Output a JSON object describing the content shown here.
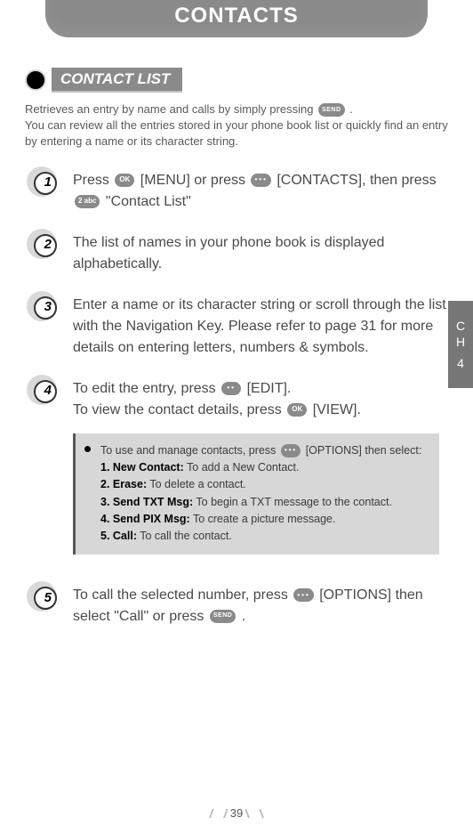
{
  "header": {
    "title": "CONTACTS"
  },
  "section": {
    "title": "CONTACT LIST"
  },
  "intro_line1": "Retrieves an entry by name and calls by simply pressing ",
  "intro_line1_tail": " .",
  "intro_line2": "You can review all the entries stored in your phone book list or quickly find an entry by entering a name or its character string.",
  "steps": {
    "s1": {
      "num": "1",
      "a": "Press ",
      "b": " [MENU] or press ",
      "c": " [CONTACTS], then press ",
      "d": " \"Contact List\""
    },
    "s2": {
      "num": "2",
      "text": "The list of names in your phone book is displayed alphabetically."
    },
    "s3": {
      "num": "3",
      "text": "Enter a name or its character string or scroll through the list with the Navigation Key. Please refer to page 31 for more details on entering letters, numbers & symbols."
    },
    "s4": {
      "num": "4",
      "a": "To edit the entry, press ",
      "b": " [EDIT].",
      "c": "To view the contact details, press ",
      "d": " [VIEW]."
    },
    "s5": {
      "num": "5",
      "a": "To call the selected number, press ",
      "b": " [OPTIONS] then select \"Call\" or press ",
      "c": " ."
    }
  },
  "options": {
    "lead_a": "To use and manage contacts, press ",
    "lead_b": " [OPTIONS] then select:",
    "o1b": "1. New Contact:",
    "o1t": " To add a New Contact.",
    "o2b": "2. Erase:",
    "o2t": " To delete a contact.",
    "o3b": "3. Send TXT Msg:",
    "o3t": " To begin a TXT message to the contact.",
    "o4b": "4. Send PIX Msg:",
    "o4t": " To create a picture message.",
    "o5b": "5. Call:",
    "o5t": " To call the contact."
  },
  "keys": {
    "ok": "OK",
    "dots": "•••",
    "abc": "2 abc",
    "twodot": "••",
    "send": "SEND"
  },
  "side": {
    "l1": "C",
    "l2": "H",
    "l3": "4"
  },
  "page_number": "39"
}
